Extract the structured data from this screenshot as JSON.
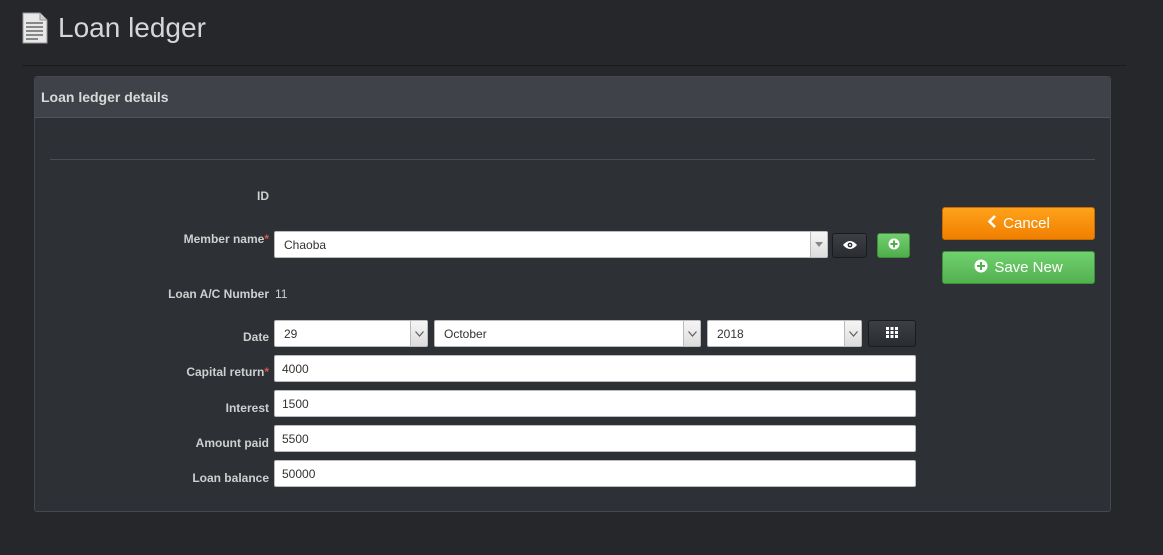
{
  "page": {
    "title": "Loan ledger"
  },
  "panel": {
    "title": "Loan ledger details"
  },
  "form": {
    "id_label": "ID",
    "member_label": "Member name",
    "member_value": "Chaoba",
    "account_label": "Loan A/C Number",
    "account_value": "11",
    "date_label": "Date",
    "date_day": "29",
    "date_month": "October",
    "date_year": "2018",
    "capital_label": "Capital return",
    "capital_value": "4000",
    "interest_label": "Interest",
    "interest_value": "1500",
    "amount_label": "Amount paid",
    "amount_value": "5500",
    "balance_label": "Loan balance",
    "balance_value": "50000",
    "required_marker": "*"
  },
  "actions": {
    "cancel_label": "Cancel",
    "save_label": "Save New"
  },
  "icons": {
    "header": "document-icon",
    "view": "eye-icon",
    "add": "plus-circle-icon",
    "calendar": "calendar-grid-icon",
    "cancel": "chevron-left-icon",
    "save": "plus-circle-icon"
  },
  "colors": {
    "cancel": "#f28a0b",
    "save": "#5cb85c",
    "required": "#e05353"
  }
}
